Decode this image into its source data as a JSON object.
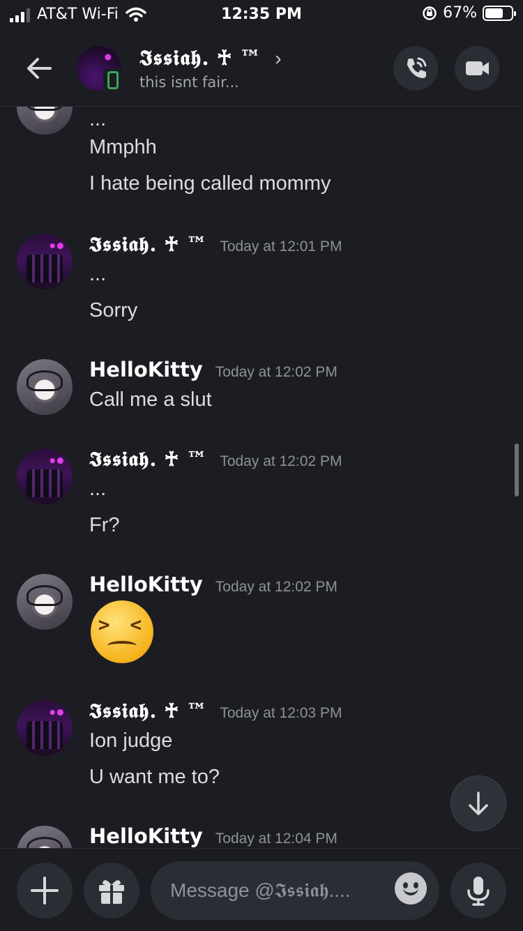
{
  "status_bar": {
    "carrier": "AT&T Wi-Fi",
    "time": "12:35 PM",
    "battery_percent": "67%",
    "battery_level": 0.67
  },
  "header": {
    "name": "𝕴𝖘𝖘𝖎𝖆𝖍. ♰ ™",
    "chevron": "›",
    "status": "this isnt fair..."
  },
  "messages": [
    {
      "author": "",
      "time": "",
      "lines": [
        "...",
        "Mmphh",
        "I hate being called mommy"
      ],
      "avatar": "hellokitty"
    },
    {
      "author": "𝕴𝖘𝖘𝖎𝖆𝖍. ♰ ™",
      "time": "Today at 12:01 PM",
      "lines": [
        "...",
        "Sorry"
      ],
      "avatar": "issiah"
    },
    {
      "author": "HelloKitty",
      "time": "Today at 12:02 PM",
      "lines": [
        "Call me a slut"
      ],
      "avatar": "hellokitty"
    },
    {
      "author": "𝕴𝖘𝖘𝖎𝖆𝖍. ♰ ™",
      "time": "Today at 12:02 PM",
      "lines": [
        "...",
        "Fr?"
      ],
      "avatar": "issiah"
    },
    {
      "author": "HelloKitty",
      "time": "Today at 12:02 PM",
      "lines": [],
      "emoji": "confounded-face",
      "avatar": "hellokitty"
    },
    {
      "author": "𝕴𝖘𝖘𝖎𝖆𝖍. ♰ ™",
      "time": "Today at 12:03 PM",
      "lines": [
        "Ion judge",
        "U want me to?"
      ],
      "avatar": "issiah"
    },
    {
      "author": "HelloKitty",
      "time": "Today at 12:04 PM",
      "lines": [],
      "avatar": "hellokitty"
    }
  ],
  "composer": {
    "placeholder": "Message @𝕴𝖘𝖘𝖎𝖆𝖍...."
  },
  "icons": {
    "back": "arrow-left-icon",
    "voice_call": "phone-call-icon",
    "video_call": "video-camera-icon",
    "add": "plus-icon",
    "gift": "gift-icon",
    "emoji": "emoji-icon",
    "mic": "microphone-icon",
    "jump": "arrow-down-icon"
  },
  "colors": {
    "background": "#1c1d22",
    "input": "#2b2d34",
    "timestamp": "#8e9199",
    "online_mobile": "#3ba55d"
  }
}
